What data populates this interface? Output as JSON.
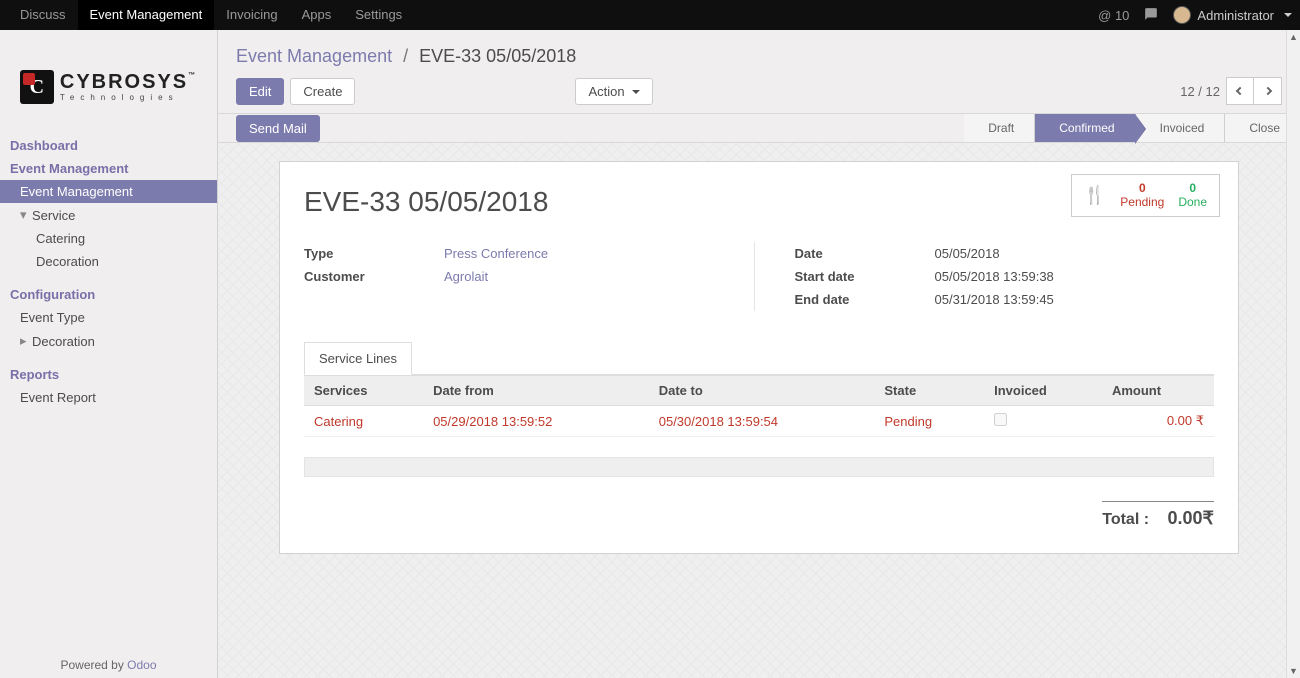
{
  "topnav": {
    "items": [
      "Discuss",
      "Event Management",
      "Invoicing",
      "Apps",
      "Settings"
    ],
    "active_index": 1,
    "at_count": "@ 10",
    "user_name": "Administrator"
  },
  "logo": {
    "name": "CYBROSYS",
    "tagline": "Technologies"
  },
  "sidebar": {
    "items": [
      {
        "type": "header",
        "label": "Dashboard"
      },
      {
        "type": "header",
        "label": "Event Management"
      },
      {
        "type": "item",
        "label": "Event Management",
        "active": true
      },
      {
        "type": "item",
        "label": "Service",
        "expandable": true,
        "expanded": true
      },
      {
        "type": "sub",
        "label": "Catering"
      },
      {
        "type": "sub",
        "label": "Decoration"
      },
      {
        "type": "header",
        "label": "Configuration"
      },
      {
        "type": "item",
        "label": "Event Type"
      },
      {
        "type": "item",
        "label": "Decoration",
        "expandable": true,
        "expanded": false
      },
      {
        "type": "header",
        "label": "Reports"
      },
      {
        "type": "item",
        "label": "Event Report"
      }
    ],
    "footer_prefix": "Powered by ",
    "footer_link": "Odoo"
  },
  "breadcrumb": {
    "link": "Event Management",
    "current": "EVE-33 05/05/2018"
  },
  "buttons": {
    "edit": "Edit",
    "create": "Create",
    "action": "Action",
    "send_mail": "Send Mail"
  },
  "pager": {
    "text": "12 / 12"
  },
  "status": {
    "steps": [
      "Draft",
      "Confirmed",
      "Invoiced",
      "Close"
    ],
    "active_index": 1
  },
  "stat_box": {
    "pending_count": "0",
    "pending_label": "Pending",
    "done_count": "0",
    "done_label": "Done"
  },
  "record": {
    "title": "EVE-33 05/05/2018",
    "labels": {
      "type": "Type",
      "customer": "Customer",
      "date": "Date",
      "start_date": "Start date",
      "end_date": "End date"
    },
    "type": "Press Conference",
    "customer": "Agrolait",
    "date": "05/05/2018",
    "start_date": "05/05/2018 13:59:38",
    "end_date": "05/31/2018 13:59:45"
  },
  "tabs": {
    "service_lines": "Service Lines"
  },
  "table": {
    "headers": {
      "services": "Services",
      "date_from": "Date from",
      "date_to": "Date to",
      "state": "State",
      "invoiced": "Invoiced",
      "amount": "Amount"
    },
    "rows": [
      {
        "service": "Catering",
        "date_from": "05/29/2018 13:59:52",
        "date_to": "05/30/2018 13:59:54",
        "state": "Pending",
        "invoiced": false,
        "amount": "0.00 ₹"
      }
    ]
  },
  "total": {
    "label": "Total :",
    "value": "0.00₹"
  }
}
